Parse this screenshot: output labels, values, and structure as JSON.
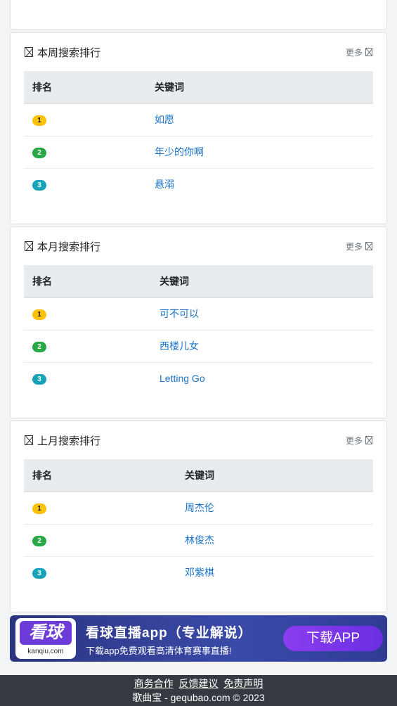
{
  "sections": [
    {
      "title": "本周搜索排行",
      "more": "更多",
      "col_rank": "排名",
      "col_keyword": "关键词",
      "rows": [
        {
          "rank": "1",
          "keyword": "如愿"
        },
        {
          "rank": "2",
          "keyword": "年少的你啊"
        },
        {
          "rank": "3",
          "keyword": "悬溺"
        }
      ]
    },
    {
      "title": "本月搜索排行",
      "more": "更多",
      "col_rank": "排名",
      "col_keyword": "关键词",
      "rows": [
        {
          "rank": "1",
          "keyword": "可不可以"
        },
        {
          "rank": "2",
          "keyword": "西楼儿女"
        },
        {
          "rank": "3",
          "keyword": "Letting Go"
        }
      ]
    },
    {
      "title": "上月搜索排行",
      "more": "更多",
      "col_rank": "排名",
      "col_keyword": "关键词",
      "rows": [
        {
          "rank": "1",
          "keyword": "周杰伦"
        },
        {
          "rank": "2",
          "keyword": "林俊杰"
        },
        {
          "rank": "3",
          "keyword": "邓紫棋"
        }
      ]
    }
  ],
  "banner": {
    "logo_text": "看球",
    "logo_domain": "kanqiu.com",
    "title": "看球直播app（专业解说）",
    "subtitle": "下载app免费观看高清体育赛事直播!",
    "button": "下载APP"
  },
  "footer": {
    "links": [
      "商务合作",
      "反馈建议",
      "免责声明"
    ],
    "copyright": "歌曲宝 - gequbao.com © 2023"
  }
}
